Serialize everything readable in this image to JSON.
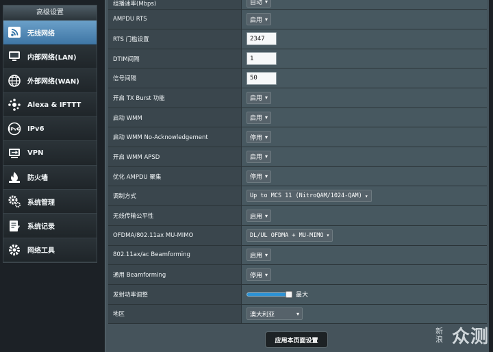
{
  "sidebar": {
    "title": "高级设置",
    "items": [
      {
        "label": "无线网络",
        "icon": "wifi-icon"
      },
      {
        "label": "内部网络(LAN)",
        "icon": "lan-icon"
      },
      {
        "label": "外部网络(WAN)",
        "icon": "globe-icon"
      },
      {
        "label": "Alexa & IFTTT",
        "icon": "alexa-icon"
      },
      {
        "label": "IPv6",
        "icon": "ipv6-icon"
      },
      {
        "label": "VPN",
        "icon": "vpn-icon"
      },
      {
        "label": "防火墙",
        "icon": "firewall-icon"
      },
      {
        "label": "系统管理",
        "icon": "gear-icon"
      },
      {
        "label": "系统记录",
        "icon": "log-icon"
      },
      {
        "label": "网络工具",
        "icon": "tools-icon"
      }
    ],
    "active_index": 0
  },
  "settings": {
    "rows": [
      {
        "label": "组播速率(Mbps)",
        "value": "自动"
      },
      {
        "label": "AMPDU RTS",
        "value": "启用"
      },
      {
        "label": "RTS 门槛设置",
        "value": "2347"
      },
      {
        "label": "DTIM间隔",
        "value": "1"
      },
      {
        "label": "信号间隔",
        "value": "50"
      },
      {
        "label": "开启 TX Burst 功能",
        "value": "启用"
      },
      {
        "label": "启动 WMM",
        "value": "启用"
      },
      {
        "label": "启动 WMM No-Acknowledgement",
        "value": "停用"
      },
      {
        "label": "开启 WMM APSD",
        "value": "启用"
      },
      {
        "label": "优化 AMPDU 聚集",
        "value": "停用"
      },
      {
        "label": "调制方式",
        "value": "Up to MCS 11 (NitroQAM/1024-QAM)"
      },
      {
        "label": "无线传输公平性",
        "value": "启用"
      },
      {
        "label": "OFDMA/802.11ax MU-MIMO",
        "value": "DL/UL OFDMA + MU-MIMO"
      },
      {
        "label": "802.11ax/ac Beamforming",
        "value": "启用"
      },
      {
        "label": "通用 Beamforming",
        "value": "停用"
      },
      {
        "label": "发射功率调整",
        "value": "最大",
        "level_percent": 100
      },
      {
        "label": "地区",
        "value": "澳大利亚"
      }
    ]
  },
  "apply_button": "应用本页面设置",
  "watermark": {
    "line1": "新浪",
    "line2": "众测"
  },
  "colors": {
    "accent": "#2c93d6",
    "active_menu": "#4f86b5"
  }
}
